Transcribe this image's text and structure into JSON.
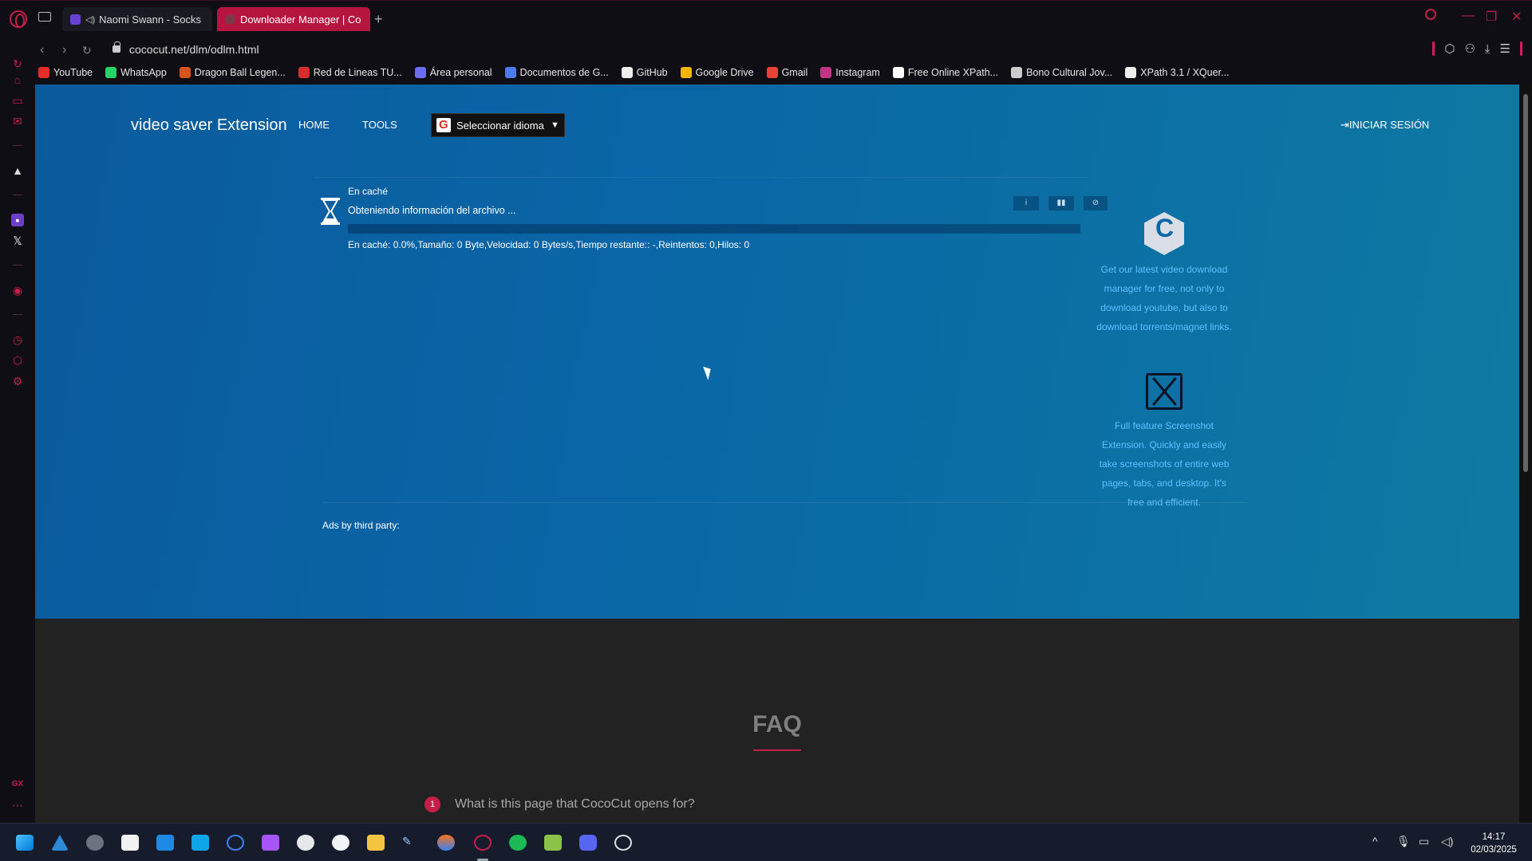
{
  "browser": {
    "tabs": [
      {
        "label": "Naomi Swann - Socks",
        "active": false
      },
      {
        "label": "Downloader Manager | Co",
        "active": true
      }
    ],
    "new_tab": "+",
    "url": "cococut.net/dlm/odlm.html"
  },
  "bookmarks": [
    {
      "label": "YouTube",
      "color": "#e52d27"
    },
    {
      "label": "WhatsApp",
      "color": "#25d366"
    },
    {
      "label": "Dragon Ball Legen...",
      "color": "#d8521b"
    },
    {
      "label": "Red de Lineas TU...",
      "color": "#d92c2c"
    },
    {
      "label": "Área personal",
      "color": "#6d6df0"
    },
    {
      "label": "Documentos de G...",
      "color": "#4b7bec"
    },
    {
      "label": "GitHub",
      "color": "#eeeeee"
    },
    {
      "label": "Google Drive",
      "color": "#f4b400"
    },
    {
      "label": "Gmail",
      "color": "#ea4335"
    },
    {
      "label": "Instagram",
      "color": "#c13584"
    },
    {
      "label": "Free Online XPath...",
      "color": "#ffffff"
    },
    {
      "label": "Bono Cultural Jov...",
      "color": "#cccccc"
    },
    {
      "label": "XPath 3.1 / XQuer...",
      "color": "#eeeeee"
    }
  ],
  "site": {
    "brand": "video saver Extension",
    "nav": {
      "home": "HOME",
      "tools": "TOOLS"
    },
    "language_select": "Seleccionar idioma",
    "login": "INICIAR SESIÓN"
  },
  "download": {
    "status": "En caché",
    "file_info": "Obteniendo información del archivo ...",
    "progress": 0,
    "stats": "En caché: 0.0%,Tamaño: 0 Byte,Velocidad: 0 Bytes/s,Tiempo restante:: -,Reintentos: 0,Hilos: 0",
    "buttons": {
      "info": "i",
      "pause": "▮▮",
      "stop": "⊘"
    }
  },
  "promos": {
    "first": "Get our latest video download manager for free, not only to download youtube, but also to download torrents/magnet links.",
    "second": "Full feature Screenshot Extension. Quickly and easily take screenshots of entire web pages, tabs, and desktop. It's free and efficient."
  },
  "ads_label": "Ads by third party:",
  "faq": {
    "title": "FAQ",
    "questions": [
      {
        "number": "1",
        "text": "What is this page that CocoCut opens for?"
      }
    ]
  },
  "taskbar": {
    "time": "14:17",
    "date": "02/03/2025"
  },
  "colors": {
    "accent": "#c61d4b",
    "hero_blue": "#0a66a6",
    "link_blue": "#5fc0ff"
  }
}
